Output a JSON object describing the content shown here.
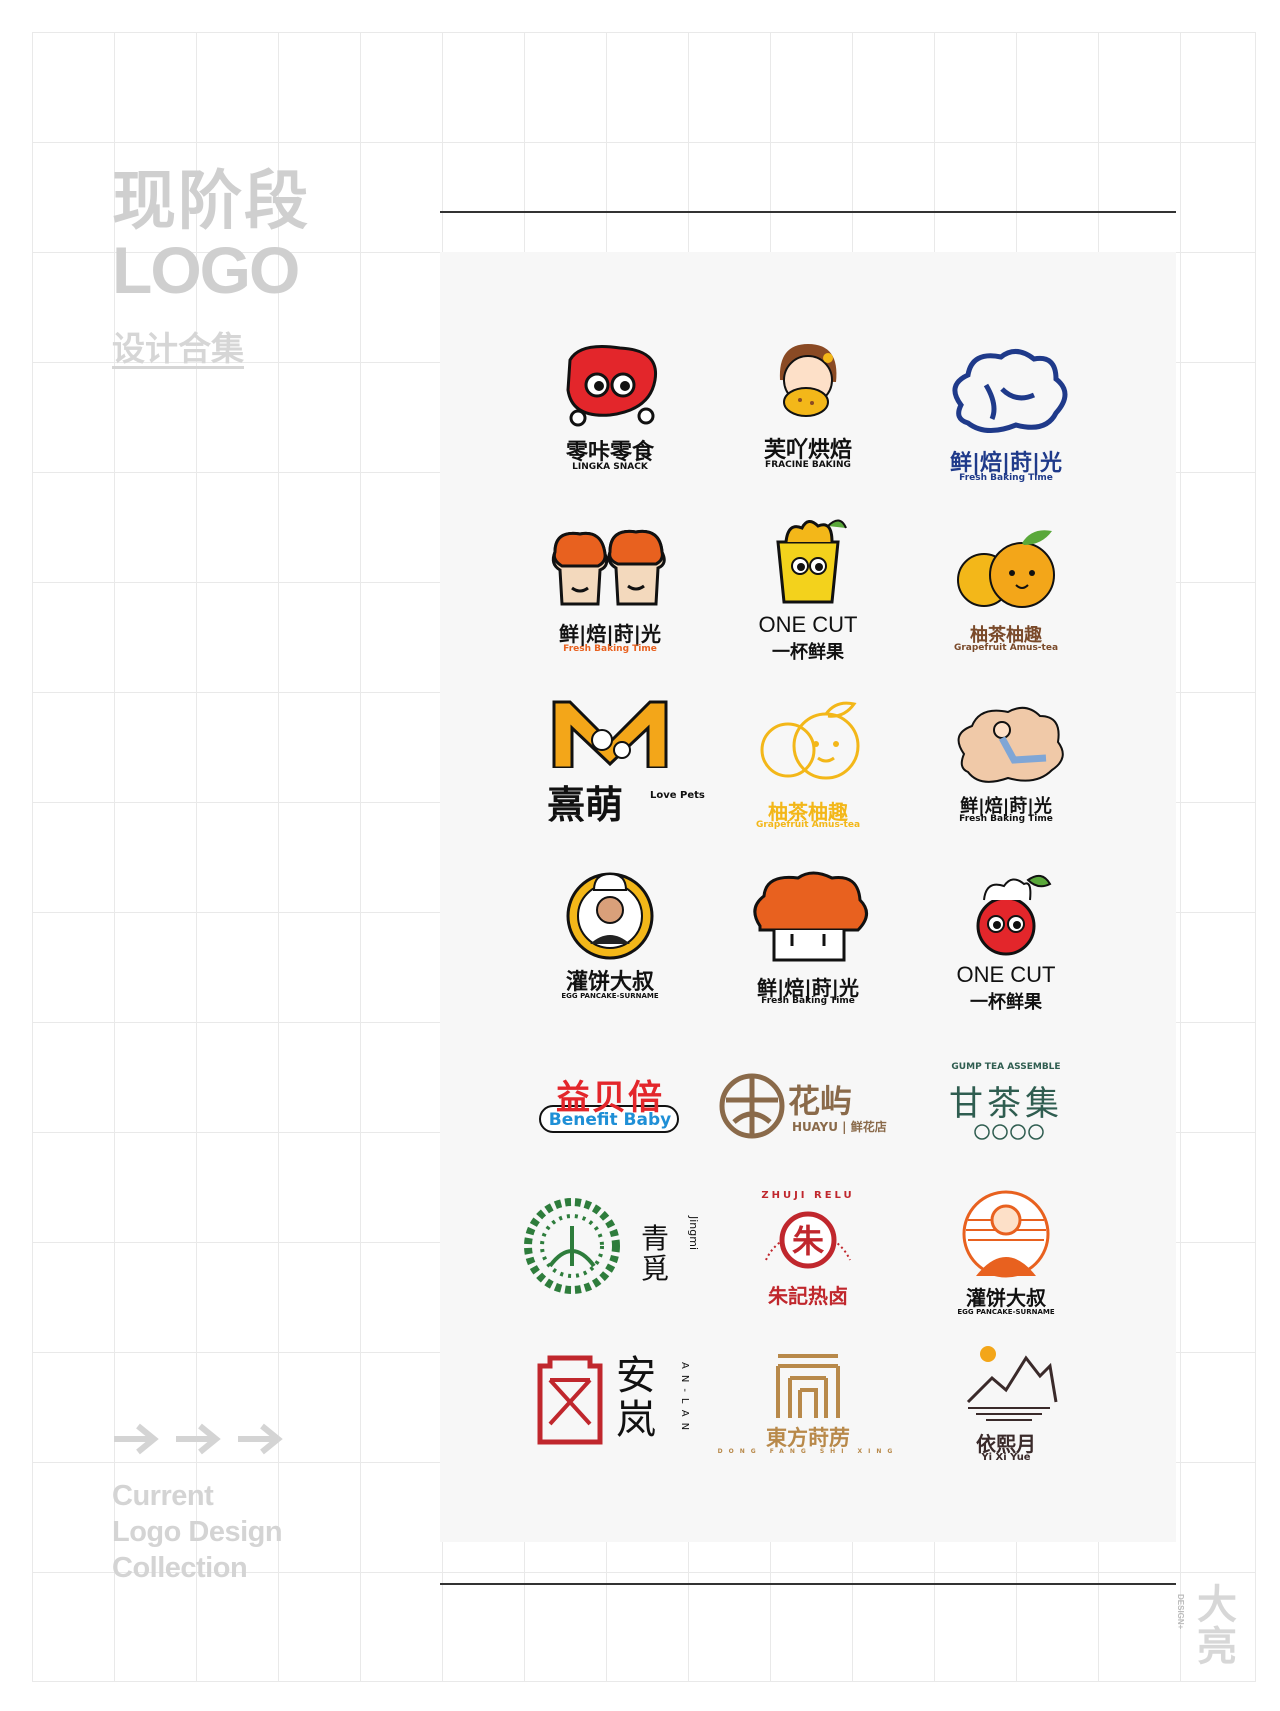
{
  "header": {
    "title_cn": "现阶段",
    "title_logo": "LOGO",
    "subtitle": "设计合集"
  },
  "footer": {
    "en_line1": "Current",
    "en_line2": "Logo Design",
    "en_line3": "Collection"
  },
  "brand": {
    "mark_line1": "大",
    "mark_line2": "亮",
    "vertical": "DESIGN+"
  },
  "colors": {
    "grid": "#e9e9e9",
    "title_gray": "#cfcfcf",
    "panel": "#f7f7f7",
    "red": "#e3262b",
    "orange": "#e8611f",
    "navy": "#1f3a8a",
    "yellow": "#f3b719",
    "brown": "#8a6a4a",
    "green": "#2e7d3c"
  },
  "logos": [
    {
      "name": "零咔零食",
      "sub": "LINGKA SNACK",
      "icon": "red-mascot-icon"
    },
    {
      "name": "芙吖烘焙",
      "sub": "FRACINE BAKING",
      "icon": "girl-bread-icon"
    },
    {
      "name": "鲜|焙|莳|光",
      "sub": "Fresh Baking Time",
      "icon": "bread-line-figure-icon"
    },
    {
      "name": "鲜|焙|莳|光",
      "sub": "Fresh Baking Time",
      "icon": "two-bread-faces-icon"
    },
    {
      "name": "ONE CUT",
      "sub": "一杯鲜果",
      "icon": "fruit-cup-mascot-icon"
    },
    {
      "name": "柚茶柚趣",
      "sub": "Grapefruit Amus-tea",
      "icon": "grapefruit-icon"
    },
    {
      "name": "熹萌",
      "sub": "Love Pets",
      "icon": "m-cat-dog-icon"
    },
    {
      "name": "柚茶柚趣",
      "sub": "Grapefruit Amus-tea",
      "icon": "grapefruit-line-icon"
    },
    {
      "name": "鲜|焙|莳|光",
      "sub": "Fresh Baking Time",
      "icon": "bread-girl-icon"
    },
    {
      "name": "灌饼大叔",
      "sub": "EGG PANCAKE-SURNAME",
      "icon": "chef-badge-icon"
    },
    {
      "name": "鲜|焙|莳|光",
      "sub": "Fresh Baking Time",
      "icon": "orange-bread-icon"
    },
    {
      "name": "ONE CUT",
      "sub": "一杯鲜果",
      "icon": "apple-mascot-icon"
    },
    {
      "name": "益贝倍",
      "sub": "Benefit Baby",
      "icon": "colorful-text-icon"
    },
    {
      "name": "花屿",
      "sub": "HUAYU | 鲜花店",
      "icon": "flower-circle-icon"
    },
    {
      "name": "甘茶集",
      "sub": "GUMP TEA ASSEMBLE",
      "icon": "tea-text-icon"
    },
    {
      "name": "青覓",
      "sub": "Jingmi",
      "icon": "green-wreath-icon"
    },
    {
      "name": "朱記热卤",
      "sub": "ZHUJI RELU",
      "icon": "red-seal-icon"
    },
    {
      "name": "灌饼大叔",
      "sub": "EGG PANCAKE-SURNAME",
      "icon": "chef-orange-icon"
    },
    {
      "name": "安岚",
      "sub": "AN-LAN",
      "icon": "red-frame-icon"
    },
    {
      "name": "東方莳苈",
      "sub": "DONG FANG SHI XING",
      "icon": "gate-icon"
    },
    {
      "name": "依熙月",
      "sub": "Yi Xi Yue",
      "icon": "mountain-sun-icon"
    }
  ]
}
